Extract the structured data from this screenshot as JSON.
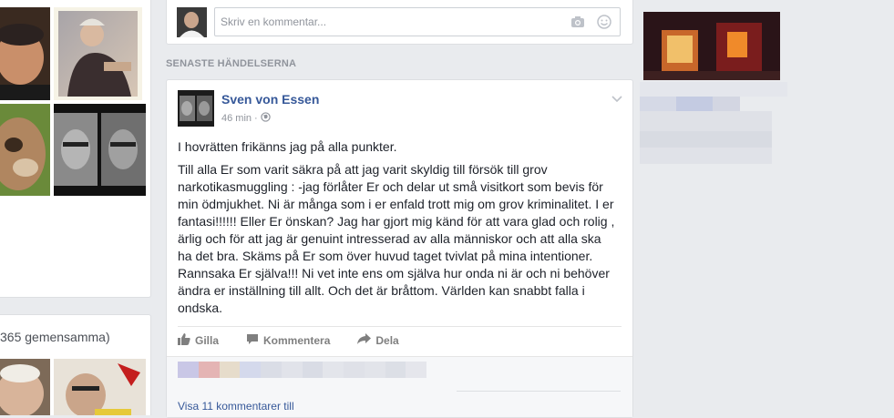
{
  "composer": {
    "placeholder": "Skriv en kommentar..."
  },
  "feed": {
    "section_title": "SENASTE HÄNDELSERNA"
  },
  "post": {
    "author": "Sven von Essen",
    "time": "46 min",
    "separator": "·",
    "first_line": "I hovrätten frikänns jag på alla punkter.",
    "body": "Till alla Er som varit säkra på att jag varit skyldig till försök till grov narkotikasmuggling : -jag förlåter Er och delar ut små visitkort som bevis för min ödmjukhet. Ni är många som i er enfald trott mig om grov kriminalitet. I er fantasi!!!!!! Eller Er önskan? Jag har gjort mig känd för att vara glad och rolig , ärlig och för att jag är genuint intresserad av alla människor och att alla ska ha det bra. Skäms på Er som över huvud taget tvivlat på mina intentioner. Rannsaka Er själva!!! Ni vet inte ens om själva hur onda ni är och ni behöver ändra er inställning till allt. Och det är bråttom. Världen kan snabbt falla i ondska.",
    "actions": {
      "like": "Gilla",
      "comment": "Kommentera",
      "share": "Dela"
    },
    "view_more": "Visa 11 kommentarer till"
  },
  "sidebar_left": {
    "mutual_friends": "365 gemensamma)"
  },
  "colors": {
    "link": "#365899",
    "background": "#e9ebee",
    "muted": "#90949c"
  },
  "icons": [
    "camera-icon",
    "smiley-icon",
    "globe-icon",
    "chevron-down-icon",
    "like-icon",
    "comment-icon",
    "share-icon"
  ]
}
